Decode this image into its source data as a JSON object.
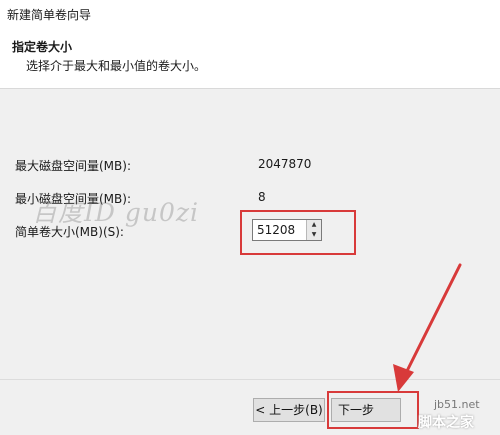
{
  "window": {
    "title": "新建简单卷向导"
  },
  "header": {
    "title": "指定卷大小",
    "subtitle": "选择介于最大和最小值的卷大小。"
  },
  "fields": {
    "max_label": "最大磁盘空间量(MB):",
    "max_value": "2047870",
    "min_label": "最小磁盘空间量(MB):",
    "min_value": "8",
    "size_label": "简单卷大小(MB)(S):",
    "size_value": "51208"
  },
  "buttons": {
    "back": "< 上一步(B)",
    "next": "下一步"
  },
  "overlay": {
    "watermark": "百度ID gu0zi",
    "site_url": "jb51.net",
    "site_name": "脚本之家",
    "highlight_color": "#d83a3a"
  }
}
